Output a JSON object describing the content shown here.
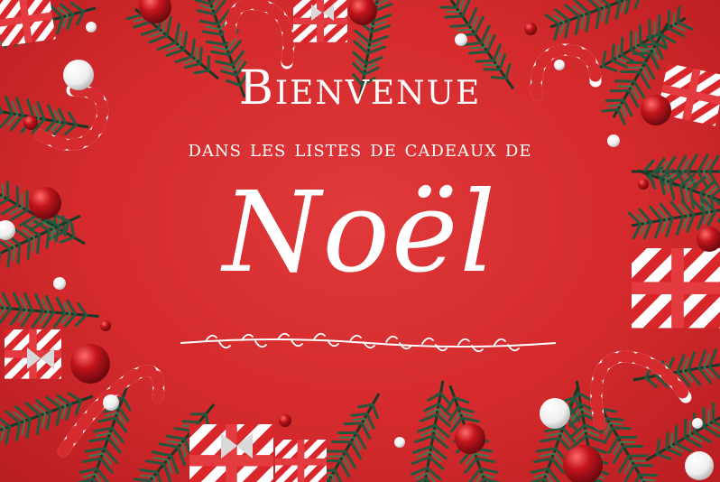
{
  "greeting": {
    "title": "Bienvenue",
    "subtitle": "dans les listes de cadeaux de",
    "highlight": "Noël"
  },
  "palette": {
    "background": "#d52b2e",
    "text": "#ffffff",
    "pine": "#1f4a34",
    "ornament": "#b3121a"
  }
}
